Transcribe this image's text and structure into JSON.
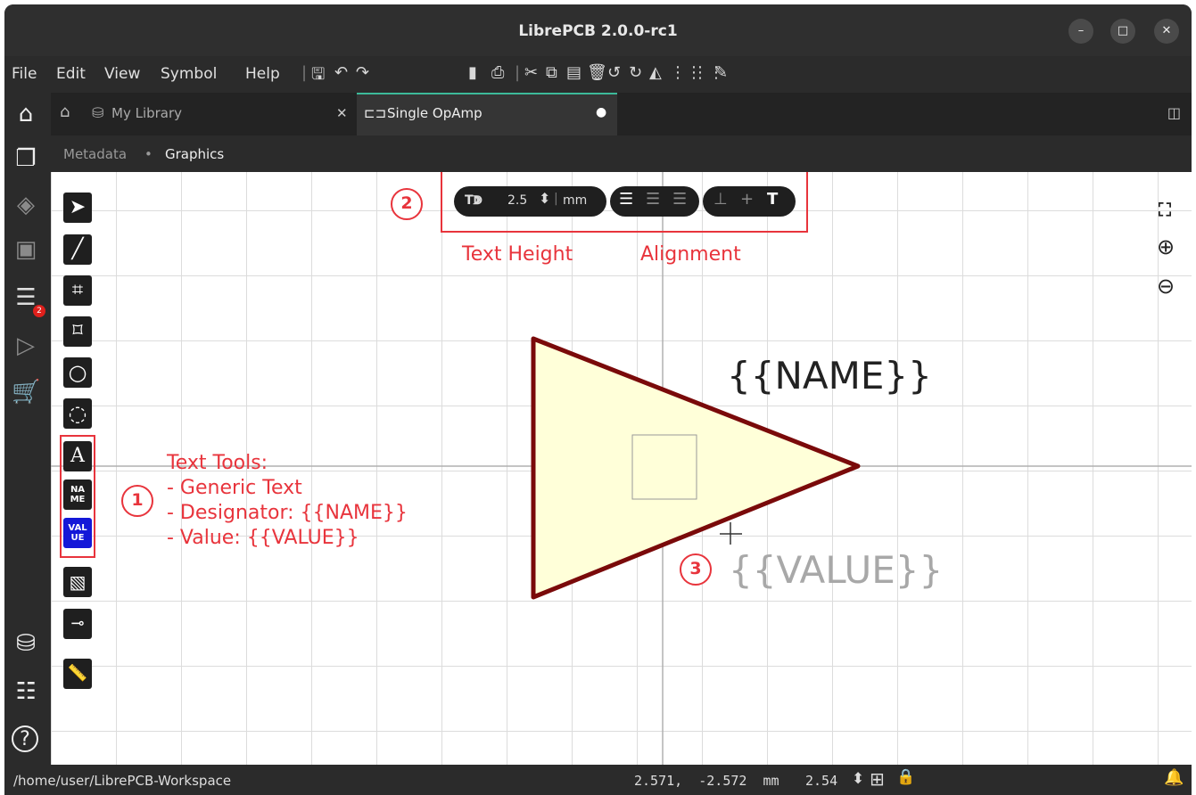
{
  "window": {
    "title": "LibrePCB 2.0.0-rc1",
    "minimize": "–",
    "maximize": "□",
    "close": "✕"
  },
  "menu": [
    "File",
    "Edit",
    "View",
    "Symbol",
    "Help"
  ],
  "tabs": [
    {
      "label": "My Library",
      "close": "✕"
    },
    {
      "label": "Single OpAmp",
      "dirty": "●"
    }
  ],
  "breadcrumb": {
    "item1": "Metadata",
    "sep": "•",
    "item2": "Graphics"
  },
  "toolbar": {
    "text_height_value": "2.5",
    "text_height_unit": "mm"
  },
  "tools": [
    {
      "name": "select-tool",
      "icon": "cursor-icon"
    },
    {
      "name": "line-tool",
      "icon": "line-icon"
    },
    {
      "name": "rectangle-tool",
      "icon": "rectangle-icon"
    },
    {
      "name": "polygon-tool",
      "icon": "polygon-icon"
    },
    {
      "name": "circle-tool",
      "icon": "circle-icon"
    },
    {
      "name": "arc-tool",
      "icon": "arc-icon"
    },
    {
      "name": "text-tool",
      "icon": "text-icon",
      "glyph": "A"
    },
    {
      "name": "name-tool",
      "label": "NA ME"
    },
    {
      "name": "value-tool",
      "label": "VAL UE"
    },
    {
      "name": "image-tool",
      "icon": "image-icon"
    },
    {
      "name": "pin-tool",
      "icon": "pin-icon"
    },
    {
      "name": "measure-tool",
      "icon": "ruler-icon"
    }
  ],
  "annotations": {
    "one": "1",
    "two": "2",
    "three": "3",
    "text_height": "Text Height",
    "alignment": "Alignment",
    "text_tools_title": "Text Tools:",
    "text_tools_1": "- Generic Text",
    "text_tools_2": "- Designator: {{NAME}}",
    "text_tools_3": "- Value: {{VALUE}}"
  },
  "symbol": {
    "name_text": "{{NAME}}",
    "value_text": "{{VALUE}}"
  },
  "status": {
    "path": "/home/user/LibrePCB-Workspace",
    "coords": "2.571,  -2.572  mm",
    "grid": "2.54"
  },
  "colors": {
    "accent": "#3cba9a",
    "annotation_red": "#e8343c",
    "symbol_outline": "#7a0a0a",
    "symbol_fill": "#ffffd9",
    "value_blue": "#1418d8",
    "badge_red": "#e0201c"
  }
}
